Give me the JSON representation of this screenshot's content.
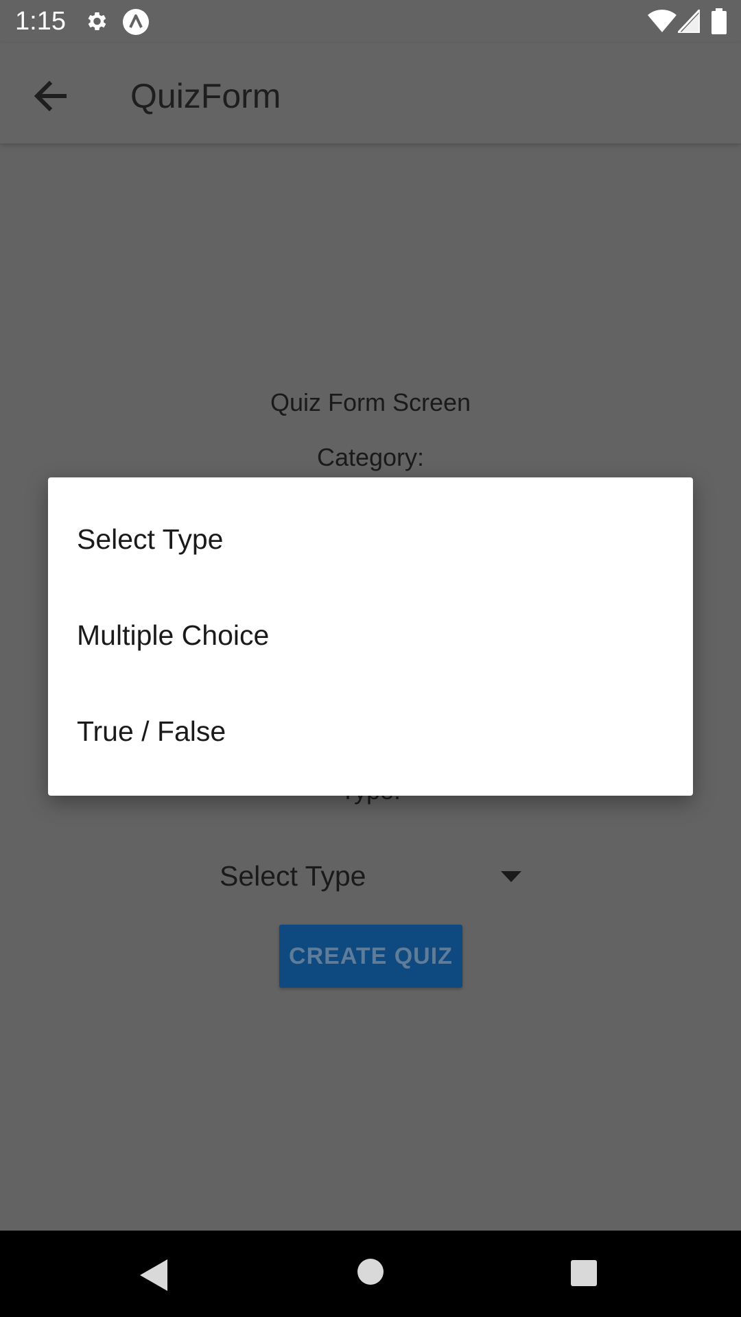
{
  "status_bar": {
    "time": "1:15",
    "icons": [
      "gear-icon",
      "app-notification-icon",
      "wifi-icon",
      "signal-icon",
      "battery-icon"
    ]
  },
  "app_bar": {
    "title": "QuizForm",
    "back_icon": "arrow-left-icon"
  },
  "form": {
    "screen_title": "Quiz Form Screen",
    "category_label": "Category:",
    "type_label": "Type:",
    "type_select_value": "Select Type",
    "create_button_label": "CREATE QUIZ"
  },
  "dialog": {
    "options": [
      "Select Type",
      "Multiple Choice",
      "True / False"
    ]
  },
  "nav_bar": {
    "icons": [
      "nav-back-icon",
      "nav-home-icon",
      "nav-recents-icon"
    ]
  },
  "colors": {
    "scrim": "#636363",
    "dialog_background": "#ffffff",
    "button_background": "#0e4a7f",
    "nav_bar": "#000000"
  }
}
